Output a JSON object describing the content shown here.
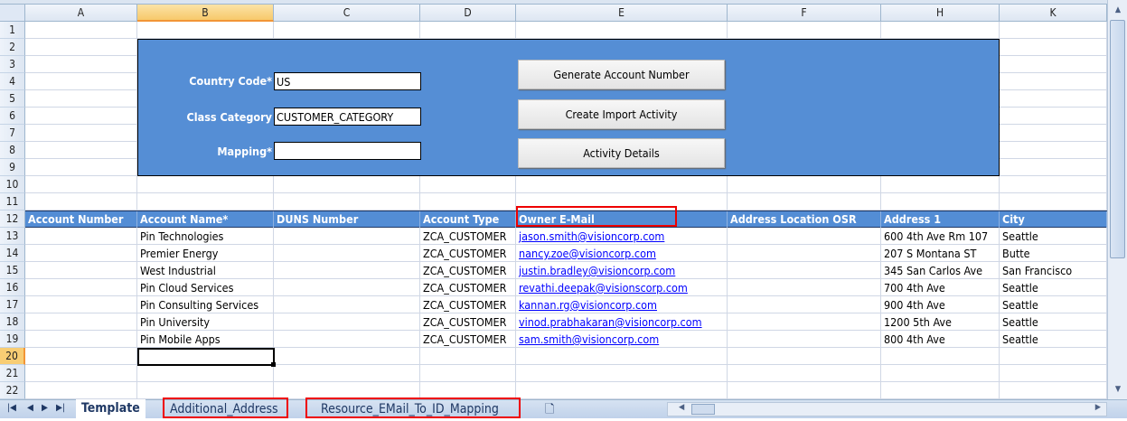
{
  "columns": [
    "A",
    "B",
    "C",
    "D",
    "E",
    "F",
    "H",
    "K"
  ],
  "selected_column": "B",
  "row_numbers": [
    "1",
    "2",
    "3",
    "4",
    "5",
    "6",
    "7",
    "8",
    "9",
    "10",
    "11",
    "12",
    "13",
    "14",
    "15",
    "16",
    "17",
    "18",
    "19",
    "20",
    "21",
    "22"
  ],
  "selected_row": "20",
  "form": {
    "country_code_label": "Country Code*",
    "country_code_value": "US",
    "class_category_label": "Class Category",
    "class_category_value": "CUSTOMER_CATEGORY",
    "mapping_label": "Mapping*",
    "mapping_value": "",
    "generate_button": "Generate Account Number",
    "import_button": "Create Import Activity",
    "details_button": "Activity Details"
  },
  "table": {
    "headers": [
      "Account Number",
      "Account Name*",
      "DUNS Number",
      "Account Type",
      "Owner E-Mail",
      "Address Location OSR",
      "Address 1",
      "City"
    ],
    "rows": [
      [
        "",
        "Pin Technologies",
        "",
        "ZCA_CUSTOMER",
        "jason.smith@visioncorp.com",
        "",
        "600 4th Ave Rm 107",
        "Seattle"
      ],
      [
        "",
        "Premier Energy",
        "",
        "ZCA_CUSTOMER",
        "nancy.zoe@visioncorp.com",
        "",
        "207 S Montana ST",
        "Butte"
      ],
      [
        "",
        "West Industrial",
        "",
        "ZCA_CUSTOMER",
        "justin.bradley@visioncorp.com",
        "",
        "345 San Carlos Ave",
        "San Francisco"
      ],
      [
        "",
        "Pin Cloud Services",
        "",
        "ZCA_CUSTOMER",
        "revathi.deepak@visionscorp.com",
        "",
        "700 4th Ave",
        "Seattle"
      ],
      [
        "",
        "Pin Consulting Services",
        "",
        "ZCA_CUSTOMER",
        "kannan.rg@visioncorp.com",
        "",
        "900 4th Ave",
        "Seattle"
      ],
      [
        "",
        "Pin University",
        "",
        "ZCA_CUSTOMER",
        "vinod.prabhakaran@visioncorp.com",
        "",
        "1200 5th Ave",
        "Seattle"
      ],
      [
        "",
        "Pin Mobile Apps",
        "",
        "ZCA_CUSTOMER",
        "sam.smith@visioncorp.com",
        "",
        "800 4th Ave",
        "Seattle"
      ]
    ]
  },
  "sheet_tabs": [
    "Template",
    "Additional_Address",
    "Resource_EMail_To_ID_Mapping"
  ],
  "active_tab": "Template",
  "colors": {
    "panel": "#558ed5",
    "header_row": "#538dd5",
    "highlight": "#ee0000",
    "link": "#0000ff"
  }
}
